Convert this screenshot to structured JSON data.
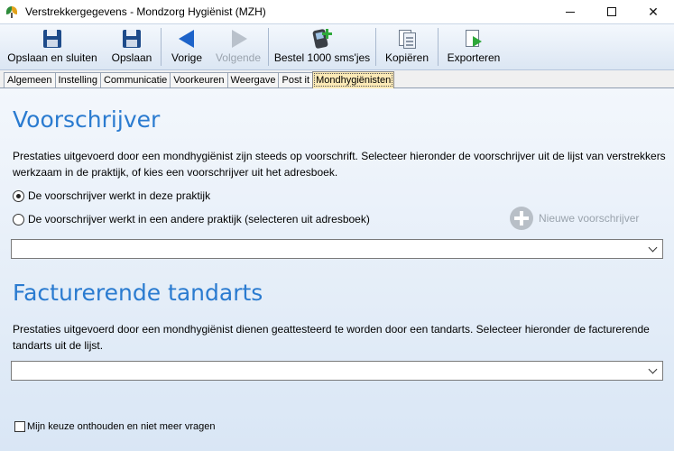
{
  "window": {
    "title": "Verstrekkergegevens - Mondzorg Hygiënist (MZH)"
  },
  "toolbar": {
    "save_close": "Opslaan en sluiten",
    "save": "Opslaan",
    "previous": "Vorige",
    "next": "Volgende",
    "order_sms": "Bestel 1000 sms'jes",
    "copy": "Kopiëren",
    "export": "Exporteren"
  },
  "tabs": [
    {
      "label": "Algemeen"
    },
    {
      "label": "Instelling"
    },
    {
      "label": "Communicatie"
    },
    {
      "label": "Voorkeuren"
    },
    {
      "label": "Weergave"
    },
    {
      "label": "Post it"
    },
    {
      "label": "Mondhygiënisten",
      "active": true
    }
  ],
  "prescriber": {
    "title": "Voorschrijver",
    "description": "Prestaties uitgevoerd door een mondhygiënist zijn steeds op voorschrift. Selecteer hieronder de voorschrijver uit de lijst van verstrekkers werkzaam in de praktijk, of kies een voorschrijver uit het adresboek.",
    "option_same": "De voorschrijver werkt in deze praktijk",
    "option_other": "De voorschrijver werkt in een andere praktijk (selecteren uit adresboek)",
    "new_button": "Nieuwe voorschrijver",
    "selected_value": ""
  },
  "billing": {
    "title": "Facturerende tandarts",
    "description": "Prestaties uitgevoerd door een mondhygiënist dienen geattesteerd te worden door een tandarts. Selecteer hieronder de facturerende tandarts uit de lijst.",
    "selected_value": ""
  },
  "remember": {
    "label": "Mijn keuze onthouden en niet meer vragen"
  }
}
